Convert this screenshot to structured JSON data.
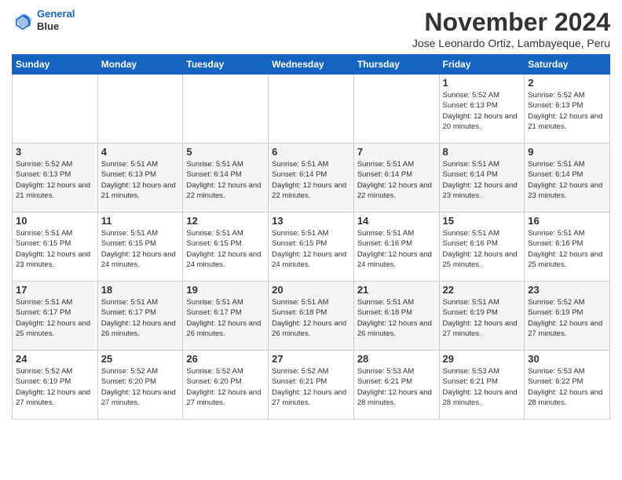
{
  "logo": {
    "line1": "General",
    "line2": "Blue"
  },
  "title": "November 2024",
  "subtitle": "Jose Leonardo Ortiz, Lambayeque, Peru",
  "days_header": [
    "Sunday",
    "Monday",
    "Tuesday",
    "Wednesday",
    "Thursday",
    "Friday",
    "Saturday"
  ],
  "weeks": [
    [
      {
        "day": "",
        "info": ""
      },
      {
        "day": "",
        "info": ""
      },
      {
        "day": "",
        "info": ""
      },
      {
        "day": "",
        "info": ""
      },
      {
        "day": "",
        "info": ""
      },
      {
        "day": "1",
        "info": "Sunrise: 5:52 AM\nSunset: 6:13 PM\nDaylight: 12 hours and 20 minutes."
      },
      {
        "day": "2",
        "info": "Sunrise: 5:52 AM\nSunset: 6:13 PM\nDaylight: 12 hours and 21 minutes."
      }
    ],
    [
      {
        "day": "3",
        "info": "Sunrise: 5:52 AM\nSunset: 6:13 PM\nDaylight: 12 hours and 21 minutes."
      },
      {
        "day": "4",
        "info": "Sunrise: 5:51 AM\nSunset: 6:13 PM\nDaylight: 12 hours and 21 minutes."
      },
      {
        "day": "5",
        "info": "Sunrise: 5:51 AM\nSunset: 6:14 PM\nDaylight: 12 hours and 22 minutes."
      },
      {
        "day": "6",
        "info": "Sunrise: 5:51 AM\nSunset: 6:14 PM\nDaylight: 12 hours and 22 minutes."
      },
      {
        "day": "7",
        "info": "Sunrise: 5:51 AM\nSunset: 6:14 PM\nDaylight: 12 hours and 22 minutes."
      },
      {
        "day": "8",
        "info": "Sunrise: 5:51 AM\nSunset: 6:14 PM\nDaylight: 12 hours and 23 minutes."
      },
      {
        "day": "9",
        "info": "Sunrise: 5:51 AM\nSunset: 6:14 PM\nDaylight: 12 hours and 23 minutes."
      }
    ],
    [
      {
        "day": "10",
        "info": "Sunrise: 5:51 AM\nSunset: 6:15 PM\nDaylight: 12 hours and 23 minutes."
      },
      {
        "day": "11",
        "info": "Sunrise: 5:51 AM\nSunset: 6:15 PM\nDaylight: 12 hours and 24 minutes."
      },
      {
        "day": "12",
        "info": "Sunrise: 5:51 AM\nSunset: 6:15 PM\nDaylight: 12 hours and 24 minutes."
      },
      {
        "day": "13",
        "info": "Sunrise: 5:51 AM\nSunset: 6:15 PM\nDaylight: 12 hours and 24 minutes."
      },
      {
        "day": "14",
        "info": "Sunrise: 5:51 AM\nSunset: 6:16 PM\nDaylight: 12 hours and 24 minutes."
      },
      {
        "day": "15",
        "info": "Sunrise: 5:51 AM\nSunset: 6:16 PM\nDaylight: 12 hours and 25 minutes."
      },
      {
        "day": "16",
        "info": "Sunrise: 5:51 AM\nSunset: 6:16 PM\nDaylight: 12 hours and 25 minutes."
      }
    ],
    [
      {
        "day": "17",
        "info": "Sunrise: 5:51 AM\nSunset: 6:17 PM\nDaylight: 12 hours and 25 minutes."
      },
      {
        "day": "18",
        "info": "Sunrise: 5:51 AM\nSunset: 6:17 PM\nDaylight: 12 hours and 26 minutes."
      },
      {
        "day": "19",
        "info": "Sunrise: 5:51 AM\nSunset: 6:17 PM\nDaylight: 12 hours and 26 minutes."
      },
      {
        "day": "20",
        "info": "Sunrise: 5:51 AM\nSunset: 6:18 PM\nDaylight: 12 hours and 26 minutes."
      },
      {
        "day": "21",
        "info": "Sunrise: 5:51 AM\nSunset: 6:18 PM\nDaylight: 12 hours and 26 minutes."
      },
      {
        "day": "22",
        "info": "Sunrise: 5:51 AM\nSunset: 6:19 PM\nDaylight: 12 hours and 27 minutes."
      },
      {
        "day": "23",
        "info": "Sunrise: 5:52 AM\nSunset: 6:19 PM\nDaylight: 12 hours and 27 minutes."
      }
    ],
    [
      {
        "day": "24",
        "info": "Sunrise: 5:52 AM\nSunset: 6:19 PM\nDaylight: 12 hours and 27 minutes."
      },
      {
        "day": "25",
        "info": "Sunrise: 5:52 AM\nSunset: 6:20 PM\nDaylight: 12 hours and 27 minutes."
      },
      {
        "day": "26",
        "info": "Sunrise: 5:52 AM\nSunset: 6:20 PM\nDaylight: 12 hours and 27 minutes."
      },
      {
        "day": "27",
        "info": "Sunrise: 5:52 AM\nSunset: 6:21 PM\nDaylight: 12 hours and 27 minutes."
      },
      {
        "day": "28",
        "info": "Sunrise: 5:53 AM\nSunset: 6:21 PM\nDaylight: 12 hours and 28 minutes."
      },
      {
        "day": "29",
        "info": "Sunrise: 5:53 AM\nSunset: 6:21 PM\nDaylight: 12 hours and 28 minutes."
      },
      {
        "day": "30",
        "info": "Sunrise: 5:53 AM\nSunset: 6:22 PM\nDaylight: 12 hours and 28 minutes."
      }
    ]
  ]
}
